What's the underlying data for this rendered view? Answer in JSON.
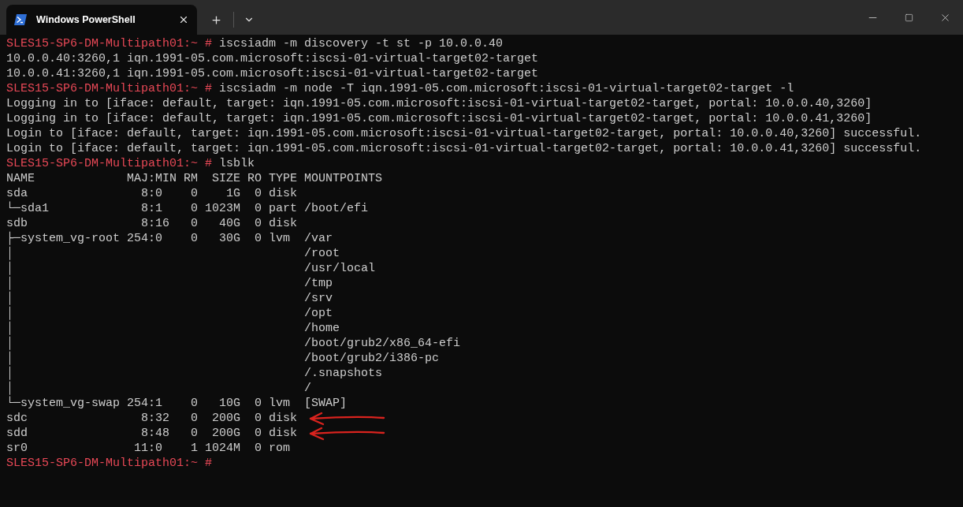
{
  "window": {
    "tab_title": "Windows PowerShell"
  },
  "lines": [
    {
      "kind": "prompt",
      "prompt": "SLES15-SP6-DM-Multipath01:~ #",
      "command": "iscsiadm -m discovery -t st -p 10.0.0.40"
    },
    {
      "kind": "output",
      "text": "10.0.0.40:3260,1 iqn.1991-05.com.microsoft:iscsi-01-virtual-target02-target"
    },
    {
      "kind": "output",
      "text": "10.0.0.41:3260,1 iqn.1991-05.com.microsoft:iscsi-01-virtual-target02-target"
    },
    {
      "kind": "prompt",
      "prompt": "SLES15-SP6-DM-Multipath01:~ #",
      "command": "iscsiadm -m node -T iqn.1991-05.com.microsoft:iscsi-01-virtual-target02-target -l"
    },
    {
      "kind": "output",
      "text": "Logging in to [iface: default, target: iqn.1991-05.com.microsoft:iscsi-01-virtual-target02-target, portal: 10.0.0.40,3260]"
    },
    {
      "kind": "output",
      "text": "Logging in to [iface: default, target: iqn.1991-05.com.microsoft:iscsi-01-virtual-target02-target, portal: 10.0.0.41,3260]"
    },
    {
      "kind": "output",
      "text": "Login to [iface: default, target: iqn.1991-05.com.microsoft:iscsi-01-virtual-target02-target, portal: 10.0.0.40,3260] successful."
    },
    {
      "kind": "output",
      "text": "Login to [iface: default, target: iqn.1991-05.com.microsoft:iscsi-01-virtual-target02-target, portal: 10.0.0.41,3260] successful."
    },
    {
      "kind": "prompt",
      "prompt": "SLES15-SP6-DM-Multipath01:~ #",
      "command": "lsblk"
    },
    {
      "kind": "output",
      "text": "NAME             MAJ:MIN RM  SIZE RO TYPE MOUNTPOINTS"
    },
    {
      "kind": "output",
      "text": "sda                8:0    0    1G  0 disk"
    },
    {
      "kind": "output",
      "text": "└─sda1             8:1    0 1023M  0 part /boot/efi"
    },
    {
      "kind": "output",
      "text": "sdb                8:16   0   40G  0 disk"
    },
    {
      "kind": "output",
      "text": "├─system_vg-root 254:0    0   30G  0 lvm  /var"
    },
    {
      "kind": "output",
      "text": "│                                         /root"
    },
    {
      "kind": "output",
      "text": "│                                         /usr/local"
    },
    {
      "kind": "output",
      "text": "│                                         /tmp"
    },
    {
      "kind": "output",
      "text": "│                                         /srv"
    },
    {
      "kind": "output",
      "text": "│                                         /opt"
    },
    {
      "kind": "output",
      "text": "│                                         /home"
    },
    {
      "kind": "output",
      "text": "│                                         /boot/grub2/x86_64-efi"
    },
    {
      "kind": "output",
      "text": "│                                         /boot/grub2/i386-pc"
    },
    {
      "kind": "output",
      "text": "│                                         /.snapshots"
    },
    {
      "kind": "output",
      "text": "│                                         /"
    },
    {
      "kind": "output",
      "text": "└─system_vg-swap 254:1    0   10G  0 lvm  [SWAP]"
    },
    {
      "kind": "marked",
      "text": "sdc                8:32   0  200G  0 disk"
    },
    {
      "kind": "marked",
      "text": "sdd                8:48   0  200G  0 disk"
    },
    {
      "kind": "output",
      "text": "sr0               11:0    1 1024M  0 rom"
    },
    {
      "kind": "prompt",
      "prompt": "SLES15-SP6-DM-Multipath01:~ #"
    }
  ]
}
